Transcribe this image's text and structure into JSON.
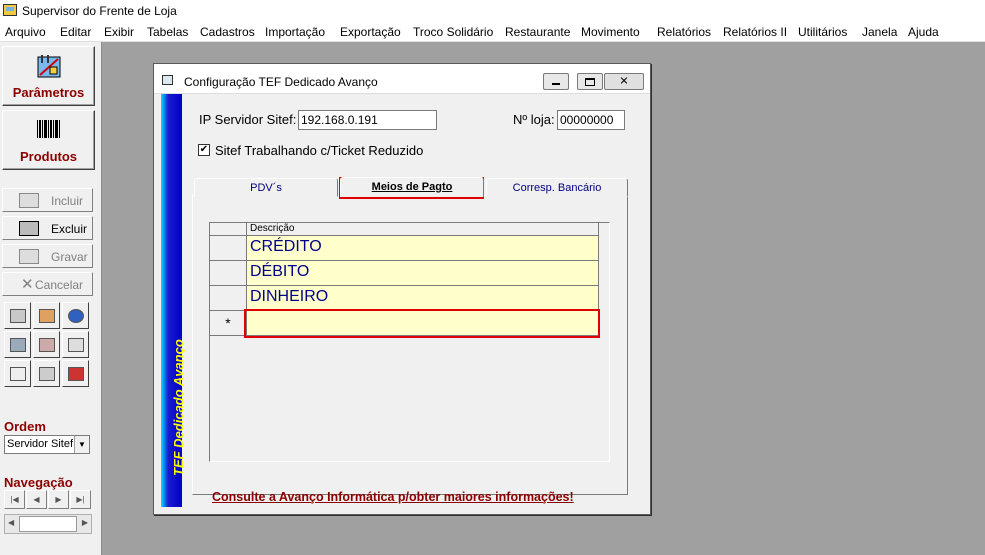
{
  "app": {
    "title": "Supervisor do Frente de Loja"
  },
  "menu": [
    "Arquivo",
    "Editar",
    "Exibir",
    "Tabelas",
    "Cadastros",
    "Importação",
    "Exportação",
    "Troco Solidário",
    "Restaurante",
    "Movimento",
    "Relatórios",
    "Relatórios II",
    "Utilitários",
    "Janela",
    "Ajuda"
  ],
  "sidebar": {
    "parametros_label": "Parâmetros",
    "produtos_label": "Produtos",
    "incluir_label": "Incluir",
    "excluir_label": "Excluir",
    "gravar_label": "Gravar",
    "cancelar_label": "Cancelar",
    "ordem_label": "Ordem",
    "ordem_value": "Servidor Sitef",
    "navegacao_label": "Navegação"
  },
  "dialog": {
    "title": "Configuração TEF Dedicado Avanço",
    "side_banner": "TEF Dedicado Avanço",
    "ip_label": "IP Servidor Sitef:",
    "ip_value": "192.168.0.191",
    "loja_label": "Nº loja:",
    "loja_value": "00000000",
    "checkbox_label": "Sitef Trabalhando c/Ticket Reduzido",
    "checkbox_checked": true,
    "tabs": [
      "PDV´s",
      "Meios de Pagto",
      "Corresp. Bancário"
    ],
    "active_tab": "Meios de Pagto",
    "grid": {
      "column_header": "Descrição",
      "rows": [
        "CRÉDITO",
        "DÉBITO",
        "DINHEIRO"
      ],
      "new_row_marker": "*"
    },
    "footer_link": "Consulte a Avanço Informática p/obter maiores informações!"
  },
  "colors": {
    "accent_dark_red": "#8b0000",
    "highlight_red": "#e00000",
    "grid_cell_yellow": "#ffffcc",
    "banner_blue": "#0000cc",
    "banner_text_yellow": "#ffff00"
  }
}
